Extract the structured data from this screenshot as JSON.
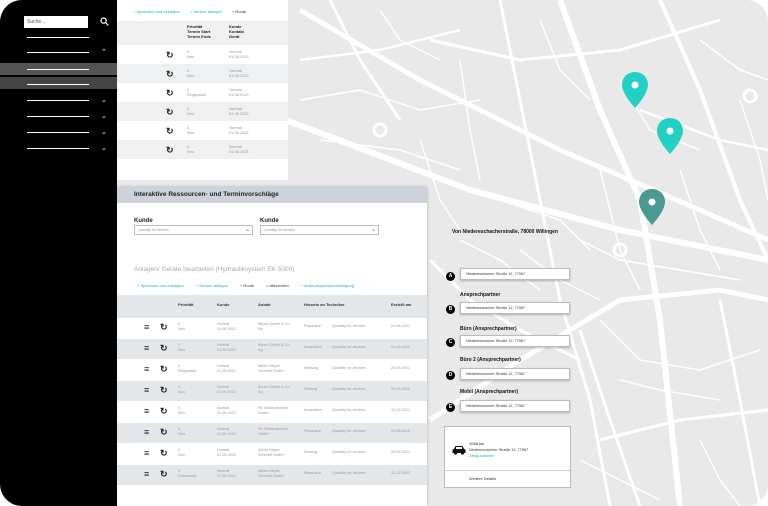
{
  "sidebar": {
    "search_placeholder": "Suche..."
  },
  "top_card": {
    "toolbar": [
      "Speichern und erledigen",
      "Service anlegen",
      "Route"
    ],
    "headers": {
      "col1": [
        "Priorität",
        "Termin Start",
        "Termin Ende"
      ],
      "col2": [
        "Kunde",
        "Kontakt",
        "Gerät"
      ]
    },
    "rows": [
      {
        "col1": [
          "4",
          "Neu"
        ],
        "col2": [
          "Normal",
          "01.06.2021"
        ]
      },
      {
        "col1": [
          "4",
          "Neu"
        ],
        "col2": [
          "Normal",
          "01.06.2021"
        ]
      },
      {
        "col1": [
          "2",
          "Eingeplant"
        ],
        "col2": [
          "Normal",
          "01.06.2021"
        ]
      },
      {
        "col1": [
          "4",
          "Neu"
        ],
        "col2": [
          "Normal",
          "01.06.2021"
        ]
      },
      {
        "col1": [
          "3",
          "Neu"
        ],
        "col2": [
          "Normal",
          "01.06.2021"
        ]
      },
      {
        "col1": [
          "4",
          "Neu"
        ],
        "col2": [
          "Normal",
          "01.06.2021"
        ]
      }
    ]
  },
  "panel": {
    "title": "Interaktive Ressourcen- und Terminvorschläge",
    "filters": [
      {
        "label": "Kunde",
        "placeholder": "Quantity for devices"
      },
      {
        "label": "Kunde",
        "placeholder": "Quantity for devices"
      }
    ],
    "section_title": "Anlagen/ Geräte bearbeiten (Hydrauliksystem EK 5000)",
    "actions": [
      "Speichern und erledigen",
      "Service anlegen",
      "Route",
      "Abbrechen",
      "Änderungsbenachrichtigung"
    ],
    "headers": [
      "Priorität",
      "Kunde",
      "Anlabt",
      "Hinweis an Techniker",
      "Erstellt am"
    ],
    "rows": [
      {
        "prio": [
          "4",
          "Neu"
        ],
        "kunde": [
          "Normal",
          "01.06.2021"
        ],
        "anlage": [
          "Bauer GmbH & Co",
          "Kg"
        ],
        "typ": "Reparatur",
        "hint": "Quantity for devices",
        "date": "01.06.2021"
      },
      {
        "prio": [
          "4",
          "Neu"
        ],
        "kunde": [
          "Normal",
          "01.06.2021"
        ],
        "anlage": [
          "Bauer GmbH & Co",
          "Kg"
        ],
        "typ": "Installation",
        "hint": "Quantity for devices",
        "date": "01.06.2021"
      },
      {
        "prio": [
          "2",
          "Eingeplant"
        ],
        "kunde": [
          "Normal",
          "01.06.2021"
        ],
        "anlage": [
          "Müller Meyer",
          "Schmidt GmbH"
        ],
        "typ": "Wartung",
        "hint": "Quantity for devices",
        "date": "20.06.2021"
      },
      {
        "prio": [
          "4",
          "Neu"
        ],
        "kunde": [
          "Normal",
          "01.06.2021"
        ],
        "anlage": [
          "Bauer GmbH & Co",
          "Kg"
        ],
        "typ": "Störung",
        "hint": "Quantity for devices",
        "date": "03.03.2020"
      },
      {
        "prio": [
          "4",
          "Neu"
        ],
        "kunde": [
          "Normal",
          "01.06.2021"
        ],
        "anlage": [
          "Fix Elektrotechnik",
          "GmbH"
        ],
        "typ": "Installation",
        "hint": "Quantity for devices",
        "date": "10.02.2021"
      },
      {
        "prio": [
          "4",
          "Neu"
        ],
        "kunde": [
          "Normal",
          "01.06.2021"
        ],
        "anlage": [
          "Fix Elektrotechnik",
          "GmbH"
        ],
        "typ": "Reparatur",
        "hint": "Quantity for devices",
        "date": "22.08.2019"
      },
      {
        "prio": [
          "4",
          "Neu"
        ],
        "kunde": [
          "Normal",
          "01.06.2021"
        ],
        "anlage": [
          "Müller Meyer",
          "Schmidt GmbH"
        ],
        "typ": "Störung",
        "hint": "Quantity for devices",
        "date": "06.09.2021"
      },
      {
        "prio": [
          "5",
          "Unbekannt"
        ],
        "kunde": [
          "Normal",
          "01.06.2021"
        ],
        "anlage": [
          "Müller Meyer",
          "Schmidt GmbH"
        ],
        "typ": "Reparatur",
        "hint": "Quantity for devices",
        "date": "31.12.2022"
      }
    ]
  },
  "route": {
    "title": "Von Niedereschacherstraße, 78000 Willingen",
    "waypoints": [
      {
        "marker": "A",
        "label": "",
        "value": "Niedereschacher Straße 12, 77967"
      },
      {
        "marker": "B",
        "label": "Ansprechpartner",
        "value": "Niedereschacher Straße 12, 77967"
      },
      {
        "marker": "C",
        "label": "Büro (Ansprechpartner)",
        "value": "Niedereschacher Straße 12, 77967"
      },
      {
        "marker": "D",
        "label": "Büro 2 (Ansprechpartner)",
        "value": "Niedereschacher Straße 12, 77967"
      },
      {
        "marker": "E",
        "label": "Mobil (Ansprechpartner)",
        "value": "Niedereschacher Straße 12, 77967"
      }
    ],
    "summary": {
      "distance": "1068 km",
      "address": "Niedereschacher Straße 12, 77967",
      "link": "Zeitig anfahren",
      "more": "Weitere Details"
    }
  },
  "colors": {
    "accent": "#18b5ae",
    "pin_teal": "#22d1c3",
    "pin_dark": "#4a9a91",
    "sidebar": "#000000"
  }
}
